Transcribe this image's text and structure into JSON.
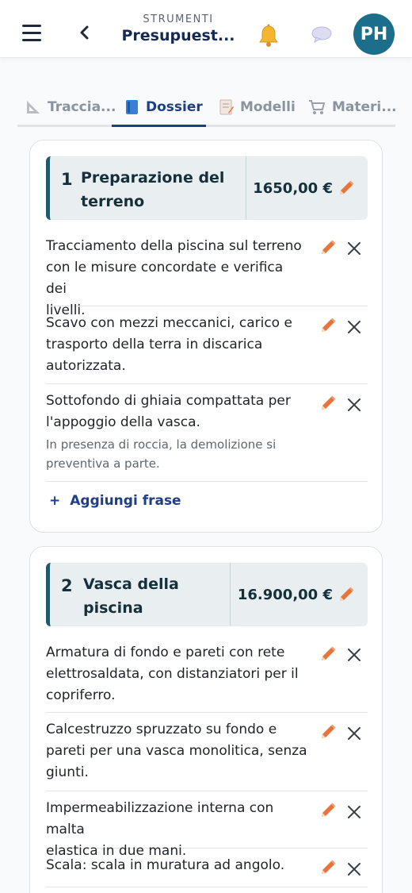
{
  "header": {
    "kicker": "STRUMENTI",
    "title": "Presupuest...",
    "avatar_initials": "PH",
    "icons": [
      "menu-icon",
      "back-chevron-icon",
      "bell-icon",
      "chat-bubble-icon"
    ]
  },
  "tabs": [
    {
      "label": "Traccia...",
      "icon": "ruler-triangle-icon"
    },
    {
      "label": "Dossier",
      "icon": "blue-book-icon",
      "active": true
    },
    {
      "label": "Modelli",
      "icon": "memo-icon"
    },
    {
      "label": "Materi...",
      "icon": "cart-icon"
    }
  ],
  "sections": [
    {
      "number": "1",
      "title_line1": "Preparazione del",
      "title_line2": "terreno",
      "amount": "1650,00 €",
      "rows": [
        {
          "lines": [
            "Tracciamento della piscina sul terreno",
            "con le misure concordate e verifica dei",
            "livelli."
          ]
        },
        {
          "lines": [
            "Scavo con mezzi meccanici, carico e",
            "trasporto della terra in discarica",
            "autorizzata."
          ]
        },
        {
          "lines": [
            "Sottofondo di ghiaia compattata per",
            "l'appoggio della vasca."
          ],
          "note_lines": [
            "In presenza di roccia, la demolizione si",
            "preventiva a parte."
          ]
        }
      ],
      "add_label": "Aggiungi frase",
      "add_symbol": "+"
    },
    {
      "number": "2",
      "title_line1": "Vasca della",
      "title_line2": "piscina",
      "amount": "16.900,00 €",
      "rows": [
        {
          "lines": [
            "Armatura di fondo e pareti con rete",
            "elettrosaldata, con distanziatori per il",
            "copriferro."
          ]
        },
        {
          "lines": [
            "Calcestruzzo spruzzato su fondo e",
            "pareti per una vasca monolitica, senza",
            "giunti."
          ]
        },
        {
          "lines": [
            "Impermeabilizzazione interna con malta",
            "elastica in due mani."
          ]
        },
        {
          "lines": [
            "Scala: scala in muratura ad angolo."
          ]
        }
      ]
    }
  ],
  "colors": {
    "accent": "#1d3f8a",
    "section_bar": "#1f5a6b",
    "avatar": "#1c6e8a",
    "pencil": "#e8743b"
  }
}
